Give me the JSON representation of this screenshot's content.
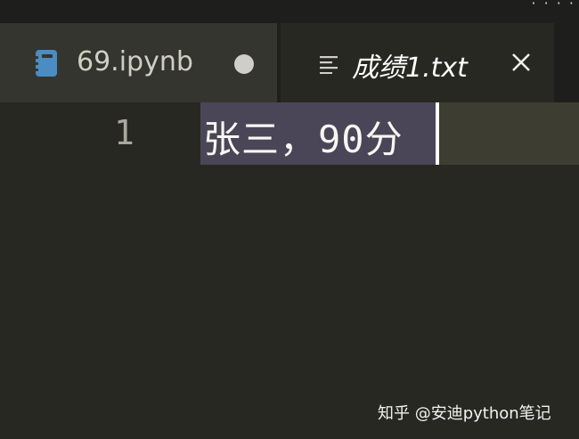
{
  "tabs": [
    {
      "label": "69.ipynb",
      "icon": "notebook-icon",
      "modified": true,
      "active": false
    },
    {
      "label": "成绩1.txt",
      "icon": "text-lines-icon",
      "modified": false,
      "active": true
    }
  ],
  "editor": {
    "lines": [
      {
        "number": "1",
        "text": "张三，90分"
      }
    ]
  },
  "watermark": "知乎 @安迪python笔记",
  "colors": {
    "background": "#272822",
    "tab_active": "#272822",
    "tab_inactive": "#34352f",
    "selection": "#4a4658",
    "notebook_icon": "#4a8cc3"
  }
}
